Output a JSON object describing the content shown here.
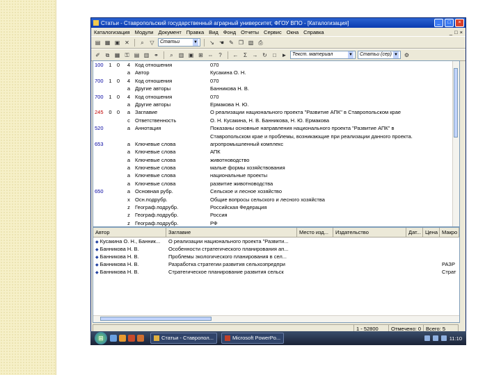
{
  "window": {
    "title": "Статьи - Ставропольский государственный аграрный университет, ФГОУ ВПО - [Каталогизация]",
    "controls": [
      "_",
      "□",
      "×"
    ]
  },
  "menu": [
    "Каталогизация",
    "Модули",
    "Документ",
    "Правка",
    "Вид",
    "Фонд",
    "Отчеты",
    "Сервис",
    "Окна",
    "Справка"
  ],
  "toolbar": {
    "db_combo": "Статьи",
    "template_combo": "Текст. материал",
    "type_combo": "Статьи (сер)"
  },
  "record": [
    {
      "tag": "100",
      "i1": "1",
      "i2": "0",
      "sub": "4",
      "name": "Код отношения",
      "value": "070",
      "red": false
    },
    {
      "tag": "",
      "i1": "",
      "i2": "",
      "sub": "а",
      "name": "Автор",
      "value": "Кусакина О. Н.",
      "red": false
    },
    {
      "tag": "700",
      "i1": "1",
      "i2": "0",
      "sub": "4",
      "name": "Код отношения",
      "value": "070",
      "red": false
    },
    {
      "tag": "",
      "i1": "",
      "i2": "",
      "sub": "а",
      "name": "Другие авторы",
      "value": "Банникова Н. В.",
      "red": false
    },
    {
      "tag": "700",
      "i1": "1",
      "i2": "0",
      "sub": "4",
      "name": "Код отношения",
      "value": "070",
      "red": false
    },
    {
      "tag": "",
      "i1": "",
      "i2": "",
      "sub": "а",
      "name": "Другие авторы",
      "value": "Ермакова Н. Ю.",
      "red": false
    },
    {
      "tag": "245",
      "i1": "0",
      "i2": "0",
      "sub": "а",
      "name": "Заглавие",
      "value": "О реализации национального проекта \"Развитие АПК\" в Ставропольском крае",
      "red": true
    },
    {
      "tag": "",
      "i1": "",
      "i2": "",
      "sub": "с",
      "name": "Ответственность",
      "value": "О. Н. Кусакина, Н. В. Банникова, Н. Ю. Ермакова",
      "red": false
    },
    {
      "tag": "520",
      "i1": "",
      "i2": "",
      "sub": "а",
      "name": "Аннотация",
      "value": "Показаны основные направления национального проекта \"Развитие АПК\" в",
      "red": false
    },
    {
      "tag": "",
      "i1": "",
      "i2": "",
      "sub": "",
      "name": "",
      "value": "Ставропольском крае и проблемы, возникающие при реализации данного проекта.",
      "red": false
    },
    {
      "tag": "653",
      "i1": "",
      "i2": "",
      "sub": "а",
      "name": "Ключевые слова",
      "value": "агропромышленный комплекс",
      "red": false
    },
    {
      "tag": "",
      "i1": "",
      "i2": "",
      "sub": "а",
      "name": "Ключевые слова",
      "value": "АПК",
      "red": false
    },
    {
      "tag": "",
      "i1": "",
      "i2": "",
      "sub": "а",
      "name": "Ключевые слова",
      "value": "животноводство",
      "red": false
    },
    {
      "tag": "",
      "i1": "",
      "i2": "",
      "sub": "а",
      "name": "Ключевые слова",
      "value": "малые формы хозяйствования",
      "red": false
    },
    {
      "tag": "",
      "i1": "",
      "i2": "",
      "sub": "а",
      "name": "Ключевые слова",
      "value": "национальные проекты",
      "red": false
    },
    {
      "tag": "",
      "i1": "",
      "i2": "",
      "sub": "а",
      "name": "Ключевые слова",
      "value": "развитие животноводства",
      "red": false
    },
    {
      "tag": "650",
      "i1": "",
      "i2": "",
      "sub": "а",
      "name": "Основная рубр.",
      "value": "Сельское и лесное хозяйство",
      "red": false
    },
    {
      "tag": "",
      "i1": "",
      "i2": "",
      "sub": "х",
      "name": "Осн.подрубр.",
      "value": "Общие вопросы сельского и лесного хозяйства",
      "red": false
    },
    {
      "tag": "",
      "i1": "",
      "i2": "",
      "sub": "z",
      "name": "Географ.подрубр.",
      "value": "Российская Федерация",
      "red": false
    },
    {
      "tag": "",
      "i1": "",
      "i2": "",
      "sub": "z",
      "name": "Географ.подрубр.",
      "value": "Россия",
      "red": false
    },
    {
      "tag": "",
      "i1": "",
      "i2": "",
      "sub": "z",
      "name": "Географ.подрубр.",
      "value": "РФ",
      "red": false
    }
  ],
  "list": {
    "columns": [
      "Автор",
      "Заглавие",
      "Место изд...",
      "Издательство",
      "Дат...",
      "Цена",
      "Макро"
    ],
    "rows": [
      {
        "author": "Кусакина О. Н., Банник...",
        "title": "О реализации национального проекта \"Развити...",
        "place": "",
        "publisher": "",
        "date": "",
        "price": "",
        "extra": ""
      },
      {
        "author": "Банникова Н. В.",
        "title": "Особенности стратегического планирования ап...",
        "place": "",
        "publisher": "",
        "date": "",
        "price": "",
        "extra": ""
      },
      {
        "author": "Банникова Н. В.",
        "title": "Проблемы экологического планирования в сел...",
        "place": "",
        "publisher": "",
        "date": "",
        "price": "",
        "extra": ""
      },
      {
        "author": "Банникова Н. В.",
        "title": "Разработка стратегии развития сельхозпредпри",
        "place": "",
        "publisher": "",
        "date": "",
        "price": "",
        "extra": "РАЗР"
      },
      {
        "author": "Банникова Н. В.",
        "title": "Стратегическое планирование развития сельск",
        "place": "",
        "publisher": "",
        "date": "",
        "price": "",
        "extra": "Страт"
      }
    ]
  },
  "status": {
    "range": "1 - 52800",
    "marked": "Отмечено: 0",
    "total": "Всего: 5"
  },
  "taskbar": {
    "tasks": [
      {
        "label": "Статьи - Ставропол...",
        "red": false
      },
      {
        "label": "Microsoft PowerPo...",
        "red": true
      }
    ],
    "clock": "11:10"
  }
}
